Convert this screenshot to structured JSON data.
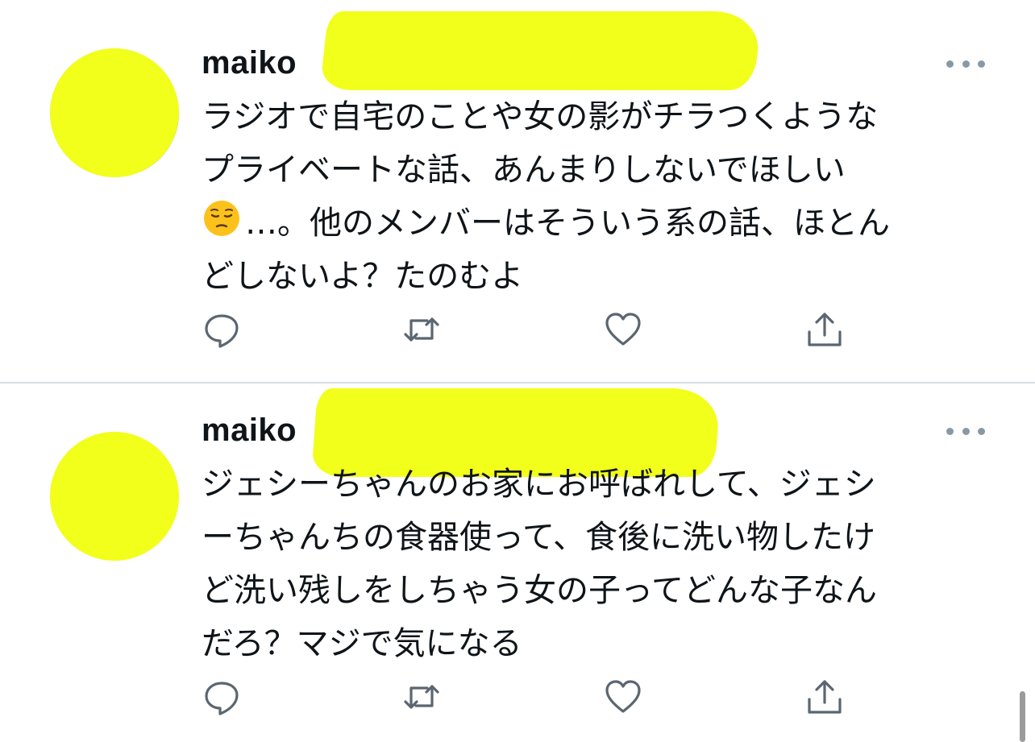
{
  "tweets": [
    {
      "author_name": "maiko",
      "text_line_1": "ラジオで自宅のことや女の影がチラつくような",
      "text_line_2": "プライベートな話、あんまりしないでほしい",
      "text_line_3": "…。他のメンバーはそういう系の話、ほとん",
      "text_line_4": "どしないよ？たのむよ",
      "emoji": "pensive-face"
    },
    {
      "author_name": "maiko",
      "text_line_1": "ジェシーちゃんのお家にお呼ばれして、ジェシ",
      "text_line_2": "ーちゃんちの食器使って、食後に洗い物したけ",
      "text_line_3": "ど洗い残しをしちゃう女の子ってどんな子なん",
      "text_line_4": "だろ？マジで気になる"
    }
  ],
  "colors": {
    "redaction": "#f2ff1a",
    "text": "#0f1419",
    "icon": "#8899a6",
    "divider": "#d8dde1"
  }
}
